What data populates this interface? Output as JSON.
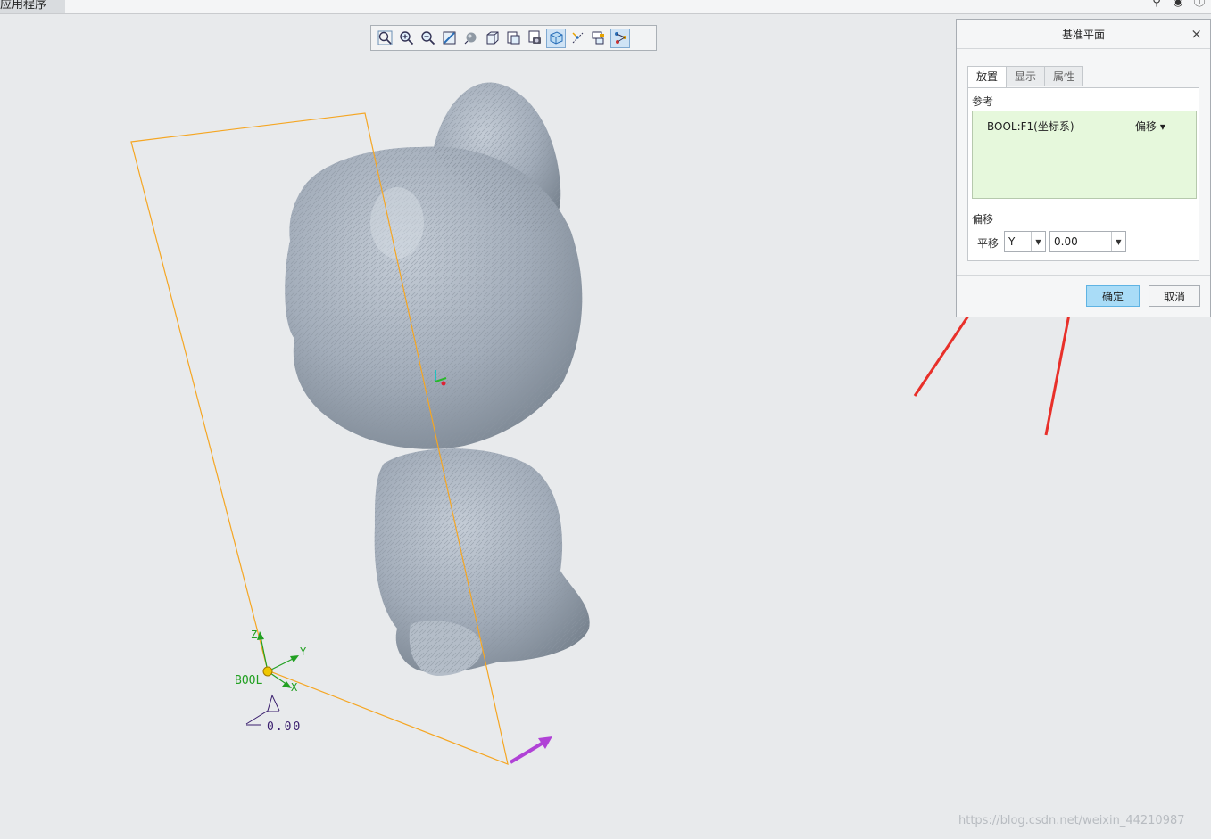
{
  "app_tab": {
    "label": "应用程序"
  },
  "toolbar": {
    "buttons": [
      "zoom-fit-icon",
      "zoom-in-icon",
      "zoom-out-icon",
      "repaint-icon",
      "display-style-icon",
      "saved-orientation-icon",
      "named-views-icon",
      "view-manager-icon",
      "datum-display-icon",
      "spin-center-icon",
      "annotation-display-icon",
      "model-tree-icon"
    ],
    "active": "datum-display-icon"
  },
  "dialog": {
    "title": "基准平面",
    "close_glyph": "×",
    "tabs": [
      "放置",
      "显示",
      "属性"
    ],
    "active_tab": "放置",
    "references_label": "参考",
    "reference_item": "BOOL:F1(坐标系)",
    "reference_constraint": "偏移 ▾",
    "offset_label": "偏移",
    "translate_label": "平移",
    "axis_value": "Y",
    "offset_value": "0.00",
    "ok_label": "确定",
    "cancel_label": "取消"
  },
  "scene": {
    "csys_name": "BOOL",
    "axis_z": "Z",
    "axis_y": "Y",
    "axis_x": "X",
    "offset_dimension": "0.00",
    "plane_color": "#f5a623",
    "model_color": "#a9b3bf"
  },
  "watermark": "https://blog.csdn.net/weixin_44210987",
  "colors": {
    "accent": "#a9dcf7",
    "reference_bg": "#e6f8dc",
    "annotation_arrow": "#e8302a"
  }
}
